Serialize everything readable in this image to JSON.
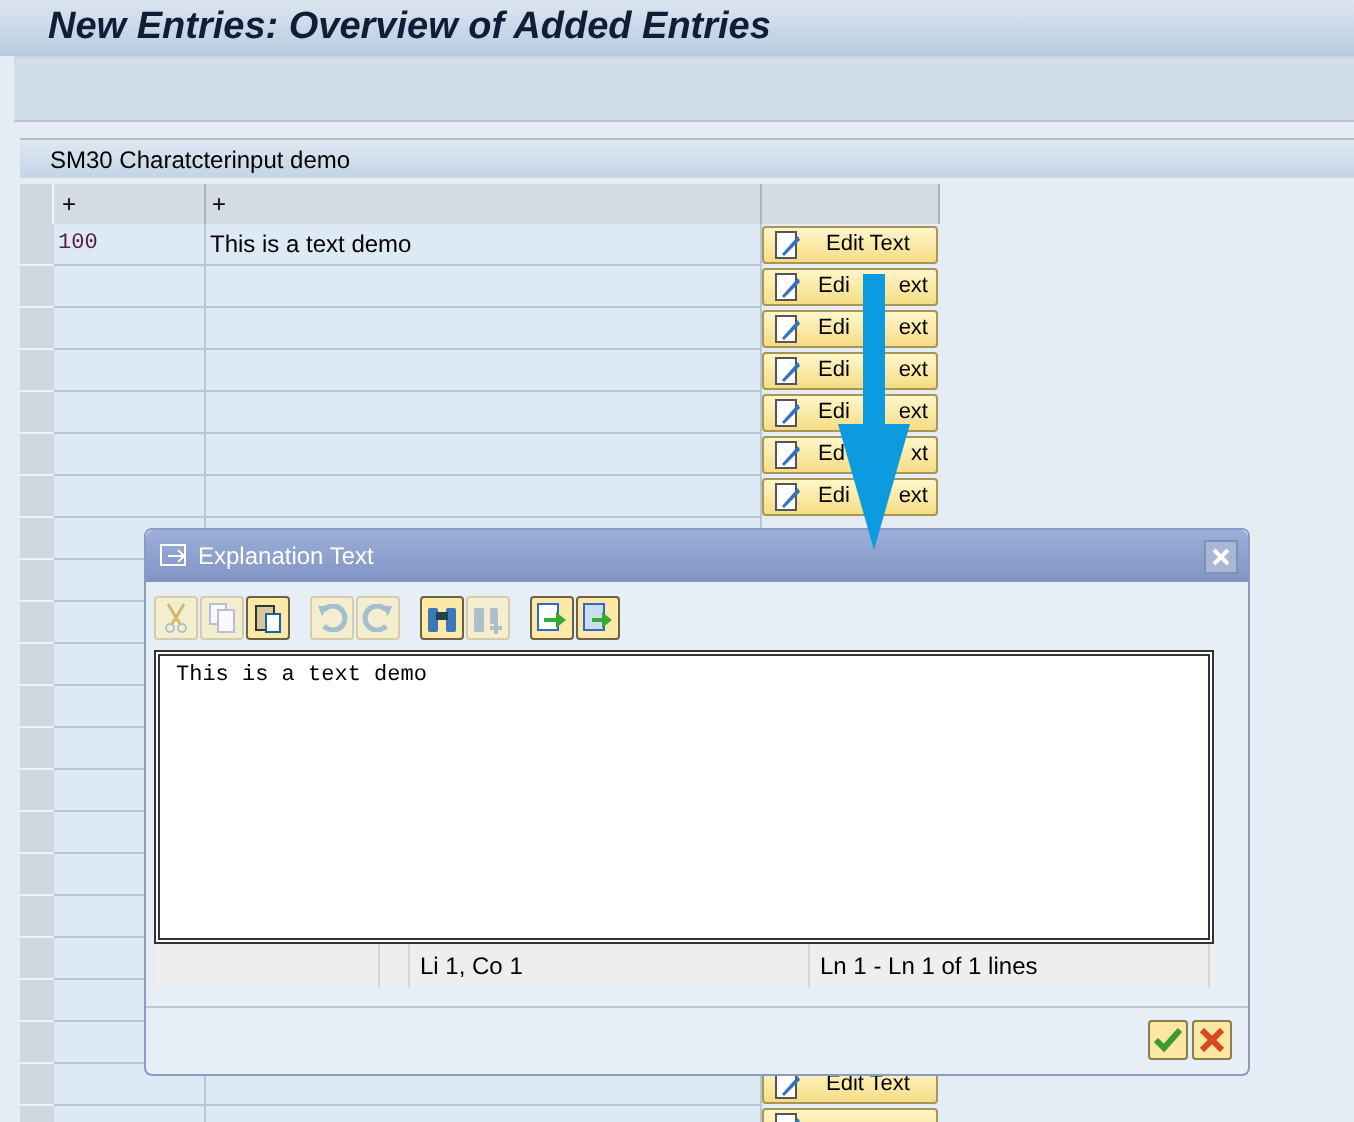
{
  "window": {
    "title": "New Entries: Overview of Added Entries"
  },
  "panel": {
    "title": "SM30 Charatcterinput demo"
  },
  "table": {
    "columns": [
      "+",
      "+"
    ],
    "rows": [
      {
        "code": "100",
        "text": "This is a text demo",
        "button": [
          "Edit Text"
        ]
      },
      {
        "button": [
          "Edi",
          "ext"
        ]
      },
      {
        "button": [
          "Edi",
          "ext"
        ]
      },
      {
        "button": [
          "Edi",
          "ext"
        ]
      },
      {
        "button": [
          "Edi",
          "ext"
        ]
      },
      {
        "button": [
          "Ed",
          "xt"
        ]
      },
      {
        "button": [
          "Edi",
          "ext"
        ]
      },
      {},
      {},
      {},
      {},
      {},
      {},
      {},
      {},
      {},
      {},
      {},
      {},
      {},
      {
        "button": [
          "Edit Text"
        ]
      },
      {
        "button": []
      }
    ]
  },
  "dialog": {
    "title": "Explanation Text",
    "toolbar": [
      {
        "kind": "cut",
        "disabled": true
      },
      {
        "kind": "copy",
        "disabled": true
      },
      {
        "kind": "paste",
        "disabled": false
      },
      {
        "kind": "gap"
      },
      {
        "kind": "undo",
        "disabled": true
      },
      {
        "kind": "redo",
        "disabled": true
      },
      {
        "kind": "gap"
      },
      {
        "kind": "find",
        "disabled": false
      },
      {
        "kind": "findnext",
        "disabled": true
      },
      {
        "kind": "gap"
      },
      {
        "kind": "import",
        "disabled": false
      },
      {
        "kind": "export",
        "disabled": false
      }
    ],
    "text": "This is a text demo",
    "status": {
      "position": "Li 1, Co 1",
      "lines": "Ln 1 - Ln 1 of 1 lines"
    }
  }
}
